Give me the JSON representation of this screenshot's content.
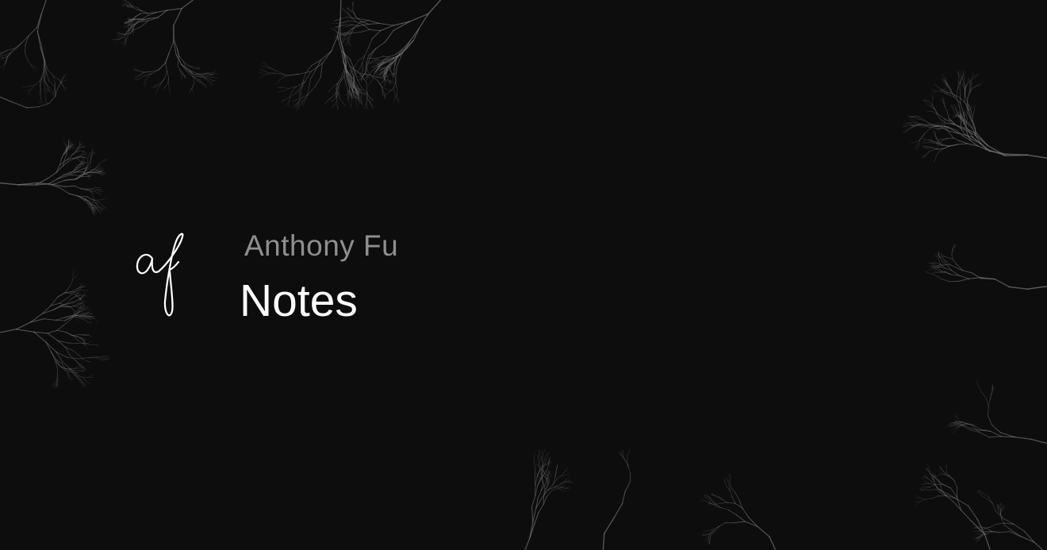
{
  "author": "Anthony Fu",
  "title": "Notes",
  "logo_lettering": "af",
  "colors": {
    "background": "#0d0d0d",
    "branches": "#8a8a8a",
    "subtitle": "#8f8f8f",
    "title": "#ffffff"
  }
}
